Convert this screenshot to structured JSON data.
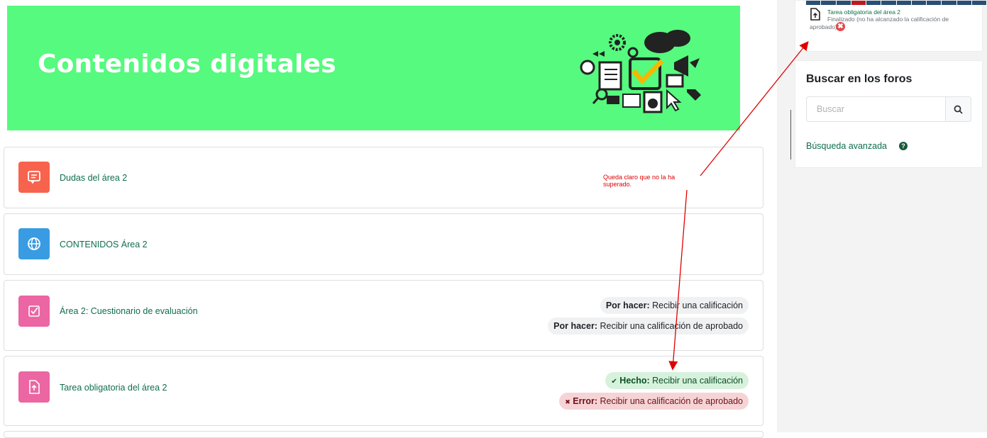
{
  "banner": {
    "title": "Contenidos digitales",
    "background": "#55fa7e"
  },
  "activities": [
    {
      "name": "Dudas del área 2",
      "icon": "forum-icon",
      "icon_color": "#f7634d",
      "conditions": []
    },
    {
      "name": "CONTENIDOS Área 2",
      "icon": "url-icon",
      "icon_color": "#399be2",
      "conditions": []
    },
    {
      "name": "Área 2: Cuestionario de evaluación",
      "icon": "quiz-icon",
      "icon_color": "#eb66a2",
      "conditions": [
        {
          "status": "Por hacer:",
          "text": "Recibir una calificación"
        },
        {
          "status": "Por hacer:",
          "text": "Recibir una calificación de aprobado"
        }
      ]
    },
    {
      "name": "Tarea obligatoria del área 2",
      "icon": "assign-icon",
      "icon_color": "#eb66a2",
      "conditions": [
        {
          "status": "Hecho:",
          "text": "Recibir una calificación",
          "mark": "✔"
        },
        {
          "status": "Error:",
          "text": "Recibir una calificación de aprobado",
          "mark": "✖"
        }
      ]
    }
  ],
  "annotation": {
    "text": "Queda claro que no la ha superado.",
    "color": "#e00000"
  },
  "completion_panel": {
    "item_title": "Tarea obligatoria del área 2",
    "item_status_line1": "Finalizado (no ha alcanzado la calificación de",
    "item_status_line2": "aprobado)",
    "fail_mark": "✖"
  },
  "forum_search": {
    "title": "Buscar en los foros",
    "placeholder": "Buscar",
    "advanced_link": "Búsqueda avanzada",
    "help_mark": "?"
  }
}
